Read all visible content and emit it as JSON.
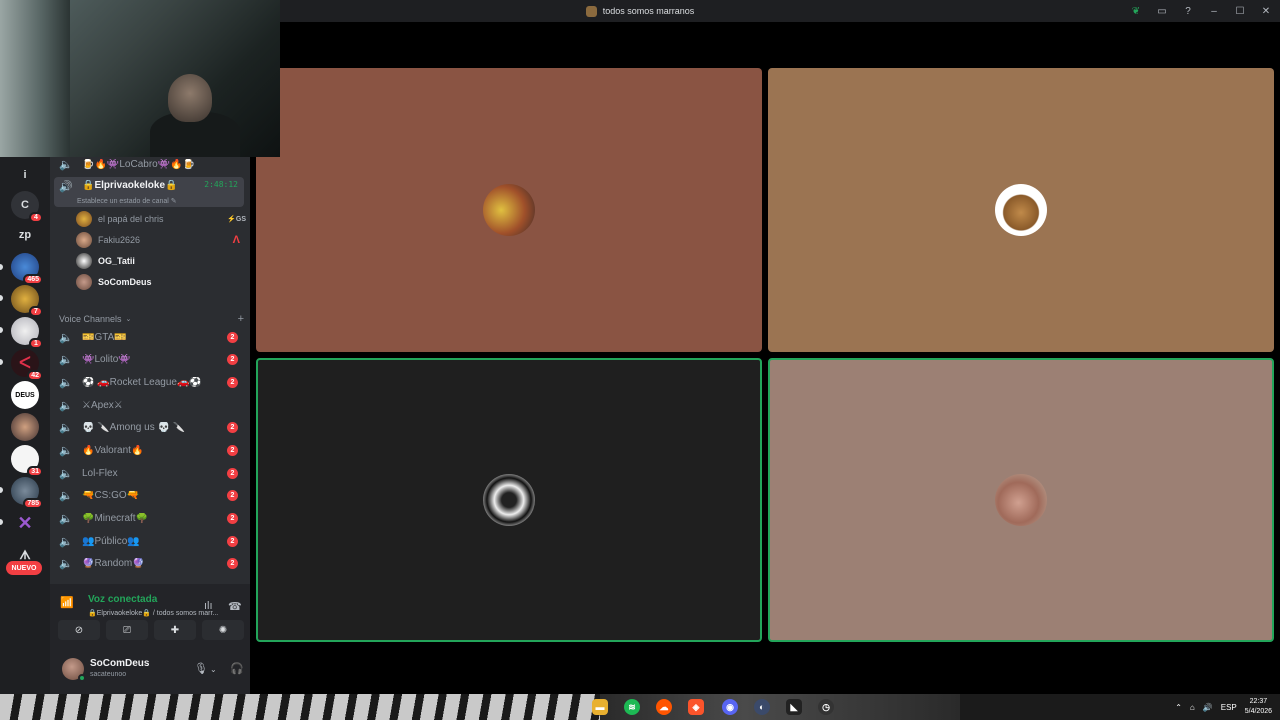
{
  "window": {
    "title": "todos somos marranos",
    "controls": [
      "minimize",
      "maximize",
      "close"
    ]
  },
  "colors": {
    "accent_green": "#23a55a",
    "badge_red": "#f23f43",
    "tile_1": "#8a5443",
    "tile_2": "#9b7452",
    "tile_3": "#1f1f1f",
    "tile_4": "#9c8074"
  },
  "server_rail": {
    "items": [
      {
        "label": "i",
        "badge": ""
      },
      {
        "label": "C",
        "badge": "4"
      },
      {
        "label": "zp",
        "badge": ""
      },
      {
        "label": "",
        "badge": "465"
      },
      {
        "label": "",
        "badge": "7"
      },
      {
        "label": "",
        "badge": "1"
      },
      {
        "label": "",
        "badge": "42"
      },
      {
        "label": "DEUS",
        "badge": ""
      },
      {
        "label": "",
        "badge": ""
      },
      {
        "label": "",
        "badge": "31"
      },
      {
        "label": "",
        "badge": "785"
      },
      {
        "label": "",
        "badge": ""
      }
    ],
    "new_label": "NUEVO"
  },
  "channels": {
    "top": {
      "name": "🍺🔥👾LoCabro👾🔥🍺"
    },
    "active": {
      "name": "🔒Elprivaokeloke🔒",
      "timer": "2:48:12",
      "status": "Establece un estado de canal ✎"
    },
    "members": [
      {
        "name": "el papá del chris",
        "tag": "⚡GS",
        "bold": false,
        "apex": ""
      },
      {
        "name": "Fakiu2626",
        "tag": "",
        "bold": false,
        "apex": "Λ"
      },
      {
        "name": "OG_Tatii",
        "tag": "",
        "bold": true,
        "apex": ""
      },
      {
        "name": "SoComDeus",
        "tag": "",
        "bold": true,
        "apex": ""
      }
    ],
    "category": "Voice Channels",
    "voice": [
      {
        "name": "🎫GTA🎫",
        "count": "2"
      },
      {
        "name": "👾Lolito👾",
        "count": "2"
      },
      {
        "name": "⚽ 🚗Rocket League🚗⚽",
        "count": "2"
      },
      {
        "name": "⚔Apex⚔",
        "count": ""
      },
      {
        "name": "💀 🔪Among us 💀 🔪",
        "count": "2"
      },
      {
        "name": "🔥Valorant🔥",
        "count": "2"
      },
      {
        "name": "Lol-Flex",
        "count": "2"
      },
      {
        "name": "🔫CS:GO🔫",
        "count": "2"
      },
      {
        "name": "🌳Minecraft🌳",
        "count": "2"
      },
      {
        "name": "👥Público👥",
        "count": "2"
      },
      {
        "name": "🔮Random🔮",
        "count": "2"
      }
    ]
  },
  "voice_panel": {
    "title": "Voz conectada",
    "subtitle": "🔒Elprivaokeloke🔒 / todos somos marr...",
    "buttons": [
      "camera-off",
      "screen-share",
      "activities",
      "soundboard"
    ]
  },
  "user": {
    "name": "SoComDeus",
    "status": "sacateunoo"
  },
  "taskbar": {
    "language": "ESP",
    "time": "22:37",
    "date": "5/4/2026"
  }
}
